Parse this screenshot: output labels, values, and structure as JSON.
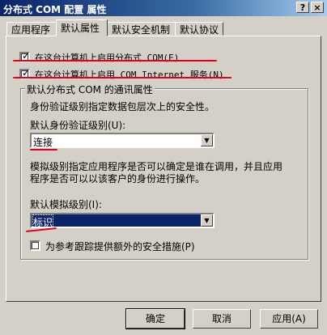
{
  "window": {
    "title": "分布式 COM 配置 属性",
    "help_button": "?",
    "close_button": "×"
  },
  "tabs": [
    {
      "label": "应用程序",
      "active": false
    },
    {
      "label": "默认属性",
      "active": true
    },
    {
      "label": "默认安全机制",
      "active": false
    },
    {
      "label": "默认协议",
      "active": false
    }
  ],
  "options": {
    "enable_dcom": {
      "label": "在这台计算机上启用分布式 COM(E)",
      "checked": true
    },
    "enable_com_internet": {
      "label": "在这台计算机上启用 COM Internet 服务(N)",
      "checked": true
    }
  },
  "group": {
    "title": "默认分布式 COM 的通讯属性",
    "auth_desc": "身份验证级别指定数据包层次上的安全性。",
    "auth_label": "默认身份验证级别(U):",
    "auth_value": "连接",
    "impersonation_desc_line1": "模拟级别指定应用程序是否可以确定是谁在调用，并且应用",
    "impersonation_desc_line2": "程序是否可以以该客户的身份进行操作。",
    "impersonation_label": "默认模拟级别(I):",
    "impersonation_value": "标识",
    "tracking": {
      "label": "为参考跟踪提供额外的安全措施(P)",
      "checked": false
    }
  },
  "buttons": {
    "ok": "确定",
    "cancel": "取消",
    "apply": "应用(A)"
  },
  "annotation_color": "#e0001b"
}
